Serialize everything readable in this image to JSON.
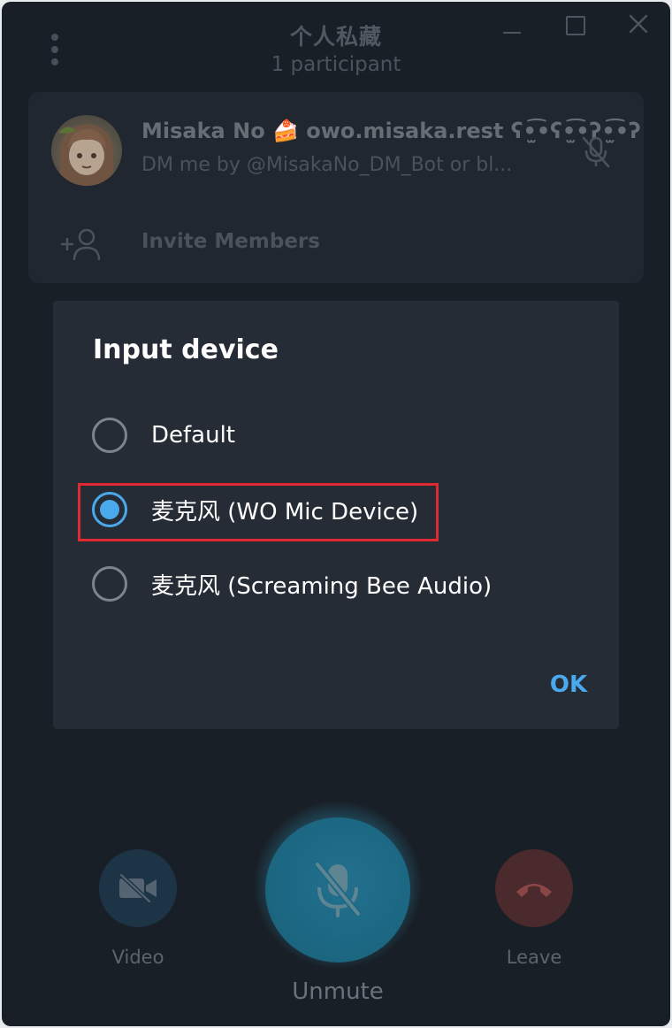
{
  "window": {
    "title": "个人私藏",
    "subtitle": "1 participant"
  },
  "participant": {
    "name": "Misaka No 🍰 owo.misaka.rest ʕ•̫͡•ʕ•̫͡•ʔ•̫͡•ʔ",
    "status": "DM me by @MisakaNo_DM_Bot or bl...",
    "invite_label": "Invite Members"
  },
  "dialog": {
    "title": "Input device",
    "options": [
      {
        "label": "Default",
        "selected": false
      },
      {
        "label": "麦克风 (WO Mic Device)",
        "selected": true
      },
      {
        "label": "麦克风 (Screaming Bee Audio)",
        "selected": false
      }
    ],
    "ok_label": "OK"
  },
  "controls": {
    "video_label": "Video",
    "unmute_label": "Unmute",
    "leave_label": "Leave"
  },
  "colors": {
    "accent": "#4aa9ec",
    "highlight_box": "#e02a33",
    "window_bg": "#191f26",
    "dialog_bg": "#262c36"
  },
  "icons": {
    "menu": "menu-dots-icon",
    "minimize": "minimize-icon",
    "maximize": "maximize-icon",
    "close": "close-icon",
    "participant_mic": "mic-muted-icon",
    "invite": "add-user-icon",
    "video": "video-off-icon",
    "unmute": "mic-muted-icon",
    "leave": "hang-up-icon"
  }
}
